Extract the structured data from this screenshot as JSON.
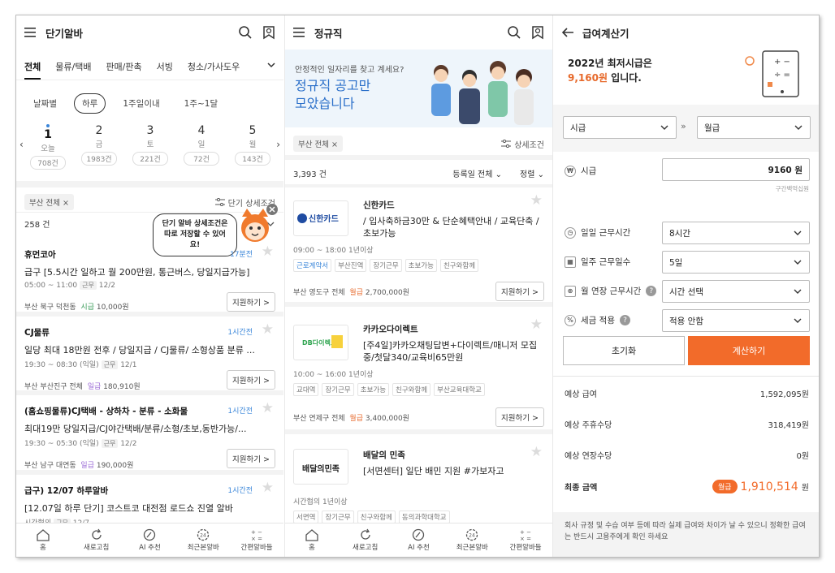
{
  "p1": {
    "title": "단기알바",
    "tabs": [
      "전체",
      "물류/택배",
      "판매/판촉",
      "서빙",
      "청소/가사도우"
    ],
    "periods": [
      "날짜별",
      "하루",
      "1주일이내",
      "1주~1달"
    ],
    "days": [
      {
        "num": "1",
        "wk": "오늘",
        "cnt": "708건"
      },
      {
        "num": "2",
        "wk": "금",
        "cnt": "1983건"
      },
      {
        "num": "3",
        "wk": "토",
        "cnt": "221건"
      },
      {
        "num": "4",
        "wk": "일",
        "cnt": "72건"
      },
      {
        "num": "5",
        "wk": "월",
        "cnt": "143건"
      }
    ],
    "filter_chip": "부산 전체 ×",
    "filter_link": "단기 상세조건",
    "count": "258 건",
    "tooltip": "단기 알바 상세조건은 따로 저장할 수 있어요!",
    "jobs": [
      {
        "co": "휴먼코아",
        "badge": "17분전",
        "desc": "급구 [5.5시간 일하고 월 200만원, 통근버스, 당일지급가능]",
        "time": "05:00 ~ 11:00",
        "tag": "근무",
        "date": "12/2",
        "loc": "부산 북구 덕천동",
        "paytype": "시급",
        "pay": "10,000원",
        "apply": "지원하기 >"
      },
      {
        "co": "CJ물류",
        "badge": "1시간전",
        "desc": "일당 최대 18만원 전후 / 당일지급 / CJ물류/ 소형상품 분류 ...",
        "time": "19:30 ~ 08:30 (익일)",
        "tag": "근무",
        "date": "12/1",
        "loc": "부산 부산진구 전체",
        "paytype": "일급",
        "pay": "180,910원",
        "apply": "지원하기 >"
      },
      {
        "co": "(홈쇼핑물류)CJ택배 - 상하차 - 분류 - 소화물",
        "badge": "1시간전",
        "desc": "최대19만 당일지급/CJ야간택배/분류/소형/초보,동반가능/...",
        "time": "19:30 ~ 05:30 (익일)",
        "tag": "근무",
        "date": "12/2",
        "loc": "부산 남구 대연동",
        "paytype": "일급",
        "pay": "190,000원",
        "apply": "지원하기 >"
      },
      {
        "co": "급구) 12/07 하루알바",
        "badge": "1시간전",
        "desc": "[12.07일 하루 단기] 코스트코 대전점 로드쇼 진열 알바",
        "time": "시간협의",
        "tag": "근무",
        "date": "12/7",
        "loc": "",
        "paytype": "",
        "pay": "",
        "apply": ""
      }
    ]
  },
  "p2": {
    "title": "정규직",
    "banner_q": "안정적인 일자리를 찾고 계세요?",
    "banner_line1": "정규직 공고만",
    "banner_line2": "모았습니다",
    "filter_chip": "부산 전체 ×",
    "filter_link": "상세조건",
    "count": "3,393 건",
    "sort1": "등록일 전체",
    "sort2": "정렬",
    "jobs": [
      {
        "logo": "신한카드",
        "co": "신한카드",
        "desc": "/ 입사축하금30만 & 단순혜택안내 / 교육단축 / 초보가능",
        "meta": "09:00 ~ 18:00   1년이상",
        "tags": [
          "근로계약서",
          "부산진역",
          "장기근무",
          "초보가능",
          "친구와함께"
        ],
        "loc": "부산 영도구 전체",
        "paytype": "월급",
        "pay": "2,700,000원",
        "apply": "지원하기 >"
      },
      {
        "logo": "DB다이렉트",
        "co": "카카오다이렉트",
        "desc": "[주4일]카카오채팅답변+다이렉트/매니저 모집중/첫달340/교육비65만원",
        "meta": "10:00 ~ 16:00   1년이상",
        "tags": [
          "교대역",
          "장기근무",
          "초보가능",
          "친구와함께",
          "부산교육대학교"
        ],
        "loc": "부산 연제구 전체",
        "paytype": "월급",
        "pay": "3,400,000원",
        "apply": "지원하기 >"
      },
      {
        "logo": "배달의민족",
        "co": "배달의 민족",
        "desc": "[서면센터] 일단 배민 지원 #가보자고",
        "meta": "시간협의   1년이상",
        "tags": [
          "서면역",
          "장기근무",
          "친구와함께",
          "동의과학대학교"
        ],
        "loc": "",
        "paytype": "",
        "pay": "",
        "apply": ""
      }
    ]
  },
  "p3": {
    "title": "급여계산기",
    "head1": "2022년 최저시급은",
    "head2_amt": "9,160원",
    "head2_rest": " 입니다.",
    "sel_from": "시급",
    "sel_to": "월급",
    "rows": [
      {
        "label": "시급",
        "value": "9160  원",
        "hint": "구간백억십원"
      },
      {
        "label": "일일 근무시간",
        "value": "8시간"
      },
      {
        "label": "일주 근무일수",
        "value": "5일"
      },
      {
        "label": "월 연장 근무시간",
        "value": "시간 선택"
      },
      {
        "label": "세금 적용",
        "value": "적용 안함"
      }
    ],
    "btn_reset": "초기화",
    "btn_calc": "계산하기",
    "results": [
      {
        "label": "예상 급여",
        "value": "1,592,095원"
      },
      {
        "label": "예상 주휴수당",
        "value": "318,419원"
      },
      {
        "label": "예상 연장수당",
        "value": "0원"
      }
    ],
    "final_label": "최종 금액",
    "final_type": "월급",
    "final_value": "1,910,514",
    "final_unit": "원",
    "note": "회사 규정 및 수습 여부 등에 따라 실제 급여와 차이가 날 수 있으니 정확한 급여는 반드시 고용주에게 확인 하세요"
  },
  "nav": [
    "홈",
    "새로고침",
    "AI 추천",
    "최근본알바",
    "간편알바들"
  ],
  "colors": {
    "accent": "#f26b2a",
    "blue": "#3a86d9",
    "green": "#3b9c5a",
    "purple": "#9b6bd6"
  }
}
